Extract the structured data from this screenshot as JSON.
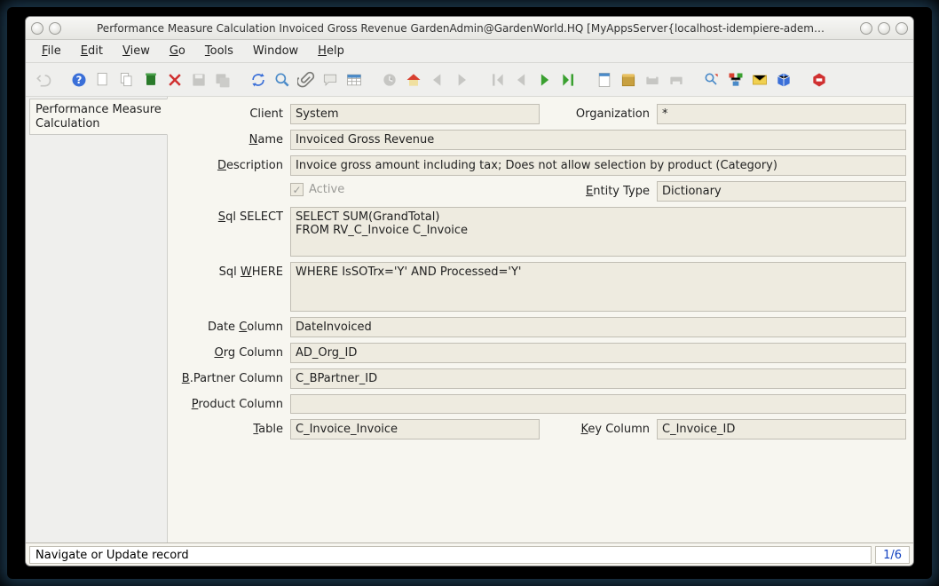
{
  "title": "Performance Measure Calculation  Invoiced Gross Revenue  GardenAdmin@GardenWorld.HQ [MyAppsServer{localhost-idempiere-adempiere}]",
  "menubar": {
    "file": "File",
    "edit": "Edit",
    "view": "View",
    "go": "Go",
    "tools": "Tools",
    "window": "Window",
    "help": "Help"
  },
  "tab": {
    "label": "Performance Measure Calculation"
  },
  "fields": {
    "client_label": "Client",
    "client_value": "System",
    "org_label": "Organization",
    "org_value": "*",
    "name_label": "Name",
    "name_value": "Invoiced Gross Revenue",
    "desc_label": "Description",
    "desc_value": "Invoice gross amount including tax; Does not allow selection by product (Category)",
    "active_label": "Active",
    "entitytype_label": "Entity Type",
    "entitytype_value": "Dictionary",
    "sqlselect_label": "Sql SELECT",
    "sqlselect_value": "SELECT SUM(GrandTotal)\nFROM RV_C_Invoice C_Invoice",
    "sqlwhere_label": "Sql WHERE",
    "sqlwhere_value": "WHERE IsSOTrx='Y' AND Processed='Y'",
    "datecol_label": "Date Column",
    "datecol_value": "DateInvoiced",
    "orgcol_label": "Org Column",
    "orgcol_value": "AD_Org_ID",
    "bpcol_label": "B.Partner Column",
    "bpcol_value": "C_BPartner_ID",
    "prodcol_label": "Product Column",
    "prodcol_value": "",
    "table_label": "Table",
    "table_value": "C_Invoice_Invoice",
    "keycol_label": "Key Column",
    "keycol_value": "C_Invoice_ID"
  },
  "status": {
    "text": "Navigate or Update record",
    "page": "1/6"
  }
}
